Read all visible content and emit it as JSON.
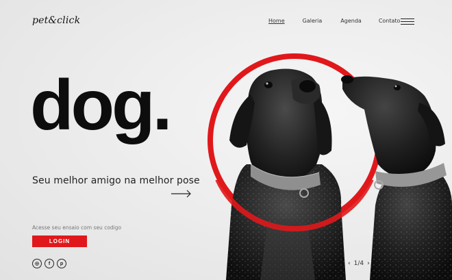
{
  "brand": {
    "logo": "pet&click"
  },
  "nav": {
    "items": [
      {
        "label": "Home",
        "active": true
      },
      {
        "label": "Galeria"
      },
      {
        "label": "Agenda"
      },
      {
        "label": "Contato"
      }
    ]
  },
  "hero": {
    "headline": "dog.",
    "tagline": "Seu melhor amigo na melhor pose"
  },
  "access": {
    "text": "Acesse seu ensaio com seu codigo",
    "button_label": "LOGIN"
  },
  "social": {
    "instagram_glyph": "◎",
    "facebook_glyph": "f",
    "pinterest_glyph": "p"
  },
  "pager": {
    "text": "1/4",
    "prev": "‹",
    "next": "›"
  },
  "colors": {
    "accent": "#e0181b",
    "background": "#ececec",
    "text": "#111111"
  }
}
